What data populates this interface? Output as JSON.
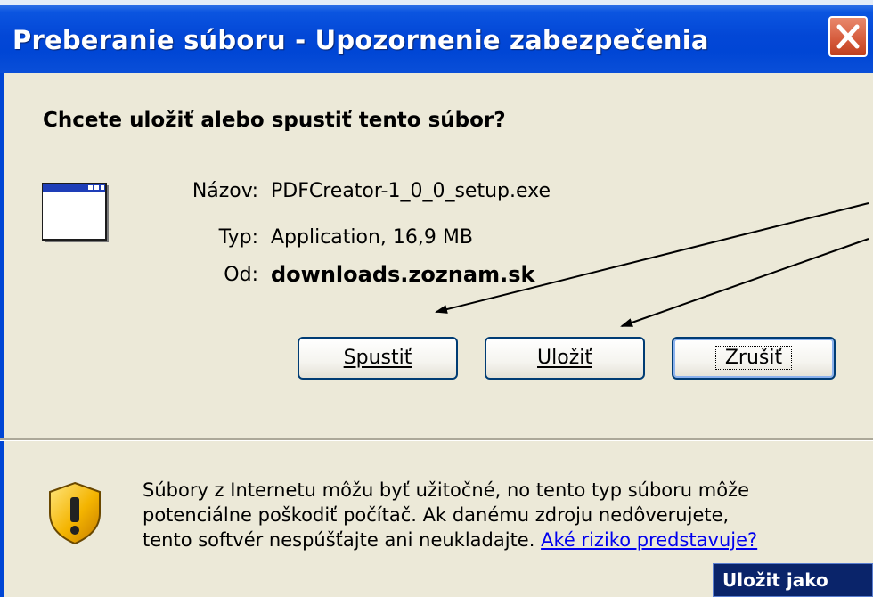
{
  "window": {
    "title": "Preberanie súboru - Upozornenie zabezpečenia",
    "close_icon": "close-icon"
  },
  "dialog": {
    "question": "Chcete uložiť alebo spustiť tento súbor?",
    "file_icon": "application-window-icon",
    "file_info": {
      "name_label": "Názov:",
      "name_value": "PDFCreator-1_0_0_setup.exe",
      "type_label": "Typ:",
      "type_value": "Application, 16,9 MB",
      "from_label": "Od:",
      "from_value": "downloads.zoznam.sk"
    },
    "buttons": {
      "run": "Spustiť",
      "save": "Uložiť",
      "cancel": "Zrušiť"
    }
  },
  "warning": {
    "icon": "security-shield-icon",
    "text_line1": "Súbory z Internetu môžu byť užitočné, no tento typ súboru môže",
    "text_line2": "potenciálne poškodiť počítač. Ak danému zdroju nedôverujete,",
    "text_line3": "tento softvér nespúšťajte ani neukladajte.",
    "link": "Aké riziko predstavuje?"
  },
  "tooltip": {
    "save_as": "Uložit jako"
  },
  "colors": {
    "titlebar": "#0046d5",
    "dialog_bg": "#ece9d8",
    "button_border": "#003c74",
    "link": "#0000ee",
    "close_button": "#d55a3b"
  }
}
